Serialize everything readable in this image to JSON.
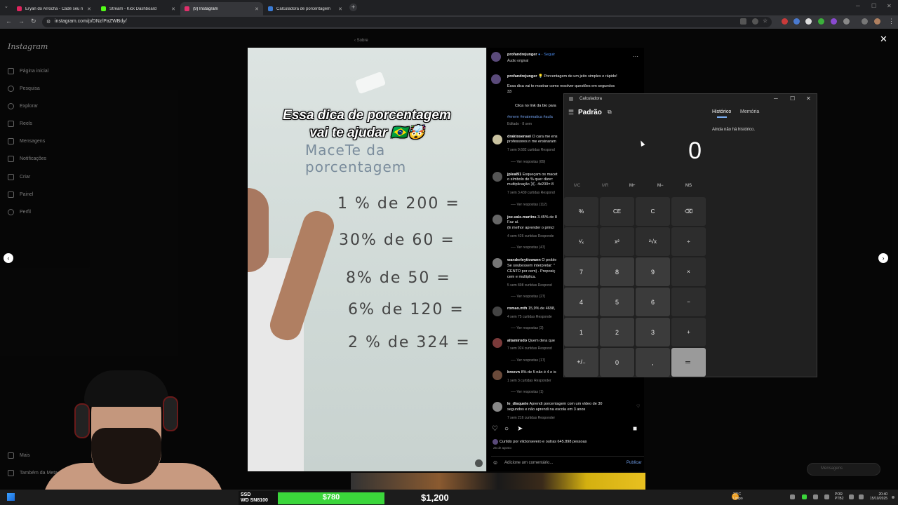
{
  "browser": {
    "tabs": [
      {
        "title": "Eryan do Arrocha - Cadê seu n",
        "color": "#e0245e"
      },
      {
        "title": "Stream - Kick Dashboard",
        "color": "#53fc18"
      },
      {
        "title": "(9) Instagram",
        "color": "#e1306c"
      },
      {
        "title": "Calculadora de porcentagem",
        "color": "#3a7bd5"
      }
    ],
    "url": "instagram.com/p/DNz/PaZWBdy/"
  },
  "instagram": {
    "logo": "Instagram",
    "back_label": "Sobre",
    "nav": [
      {
        "label": "Página inicial",
        "icon": "home-icon"
      },
      {
        "label": "Pesquisa",
        "icon": "search-icon"
      },
      {
        "label": "Explorar",
        "icon": "compass-icon"
      },
      {
        "label": "Reels",
        "icon": "reels-icon"
      },
      {
        "label": "Mensagens",
        "icon": "messages-icon"
      },
      {
        "label": "Notificações",
        "icon": "heart-icon"
      },
      {
        "label": "Criar",
        "icon": "plus-icon"
      },
      {
        "label": "Painel",
        "icon": "dashboard-icon"
      },
      {
        "label": "Perfil",
        "icon": "profile-icon"
      }
    ],
    "more_label": "Mais",
    "also_label": "Também da Meta",
    "messages_pill": "Mensagens"
  },
  "video": {
    "title_line1": "Essa dica de porcentagem",
    "title_line2": "vai te ajudar",
    "board_heading": "MaceTe da porcentagem",
    "equations": [
      "1 % de 200 =",
      "30% de 60 =",
      "8% de 50 =",
      "6% de 120 =",
      "2 % de 324 ="
    ]
  },
  "post": {
    "author": "profandrejunger",
    "follow": "Seguir",
    "audio": "Áudio original",
    "caption": "Porcentagem de um jeito simples e rápido!",
    "caption2": "Essa dica vai te mostrar como resolver questões em segundos",
    "caption3": "33",
    "bio_link": "Clica no link da bio para",
    "hashtags": "#enem #matematica #aula",
    "edited": "Editado · 8 sem",
    "comments": [
      {
        "user": "draktosensei",
        "text": "O cara me ens",
        "text2": "professores n me ensinaram",
        "meta": "7 sem   9.682 curtidas   Respond",
        "replies": "Ver respostas (89)"
      },
      {
        "user": "jpleal91",
        "text": "Esqueçam os macet",
        "text2": "o símbolo de % quer dizer:",
        "text3": "multiplicação ✖️. 4x200= 8",
        "meta": "7 sem   3.439 curtidas   Respond",
        "replies": "Ver respostas (112)"
      },
      {
        "user": "joe.vale.martins",
        "text": "3.45% de 8",
        "text2": "Faz aí.",
        "text3": "(E melhor aprender o princí",
        "meta": "4 sem   426 curtidas   Responde",
        "replies": "Ver respostas (47)"
      },
      {
        "user": "wanderleytiowann",
        "text": "O proble",
        "text2": "Se soubessem interpretar: \"",
        "text3": "CENTO por cem) . Preposiç",
        "text4": "cem e multiplica.",
        "meta": "5 sem   898 curtidas   Respond",
        "replies": "Ver respostas (27)"
      },
      {
        "user": "romao.mth",
        "text": "15,9% de 4698,",
        "meta": "4 sem   75 curtidas   Responde",
        "replies": "Ver respostas (3)"
      },
      {
        "user": "altamirodo",
        "text": "Quem dera que",
        "meta": "7 sem   924 curtidas   Respond",
        "replies": "Ver respostas (17)"
      },
      {
        "user": "breevn",
        "text": "8% de 5 não é 4 e is",
        "meta": "1 sem   3 curtidas   Responder",
        "replies": "Ver respostas (1)"
      },
      {
        "user": "le_disquete",
        "text": "Aprendi porcentagem com um vídeo de 30",
        "text2": "segundos e não aprendi na escola em 3 anos",
        "meta": "7 sem   216 curtidas   Responder",
        "replies": ""
      }
    ],
    "likes": "Curtido por vilctorsevero e outras 645.898 pessoas",
    "date": "25 de agosto",
    "comment_placeholder": "Adicione um comentário...",
    "publish": "Publicar"
  },
  "calculator": {
    "title": "Calculadora",
    "mode": "Padrão",
    "display": "0",
    "history_tab": "Histórico",
    "memory_tab": "Memória",
    "history_empty": "Ainda não há histórico.",
    "memory_keys": [
      "MC",
      "MR",
      "M+",
      "M−",
      "MS"
    ],
    "keys": [
      [
        "%",
        "CE",
        "C",
        "⌫"
      ],
      [
        "¹⁄ₓ",
        "x²",
        "²√x",
        "÷"
      ],
      [
        "7",
        "8",
        "9",
        "×"
      ],
      [
        "4",
        "5",
        "6",
        "−"
      ],
      [
        "1",
        "2",
        "3",
        "+"
      ],
      [
        "+/₋",
        "0",
        ",",
        "="
      ]
    ]
  },
  "stream_overlay": {
    "ssd_line1": "SSD",
    "ssd_line2": "WD SN8100",
    "price_green": "$780",
    "price_black": "$1,200"
  },
  "taskbar": {
    "weather_temp": "27°C",
    "weather_desc": "Limpo",
    "lang1": "POR",
    "lang2": "PTB2",
    "time": "20:40",
    "date": "15/10/2025"
  }
}
